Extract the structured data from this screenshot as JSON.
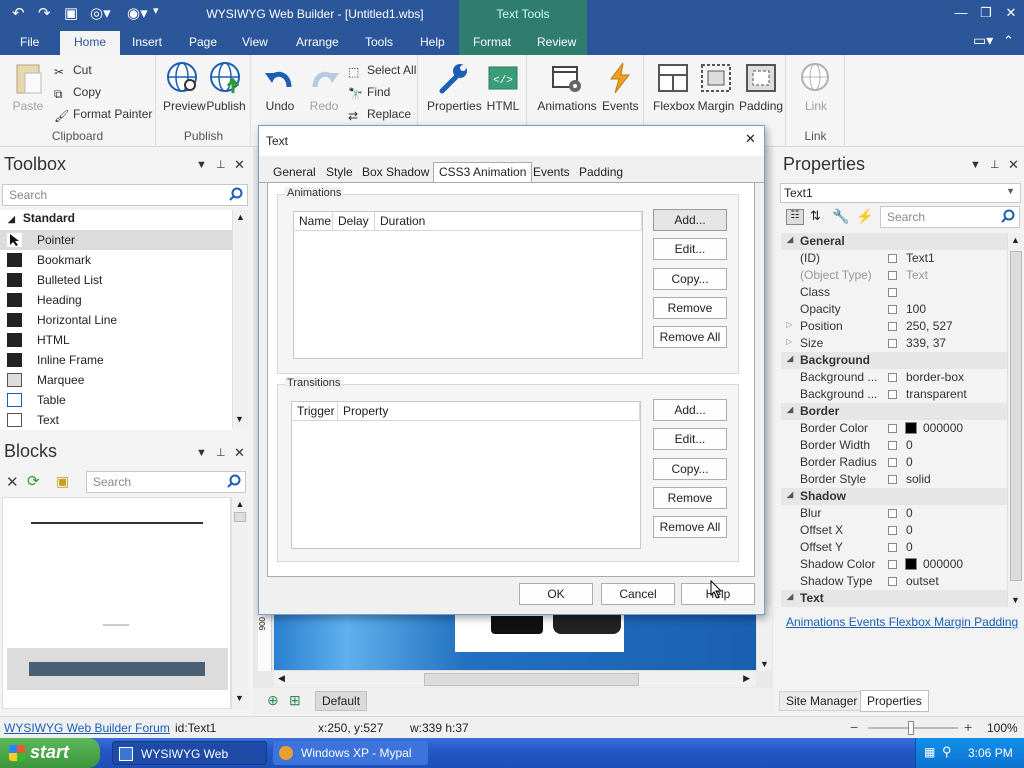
{
  "titlebar": {
    "title": "WYSIWYG Web Builder - [Untitled1.wbs]",
    "context_tab": "Text Tools"
  },
  "menu_tabs": [
    "File",
    "Home",
    "Insert",
    "Page",
    "View",
    "Arrange",
    "Tools",
    "Help",
    "Format",
    "Review"
  ],
  "active_tab": "Home",
  "ribbon": {
    "clipboard": {
      "paste": "Paste",
      "cut": "Cut",
      "copy": "Copy",
      "format_painter": "Format Painter",
      "label": "Clipboard"
    },
    "publish": {
      "preview": "Preview",
      "publish": "Publish",
      "label": "Publish"
    },
    "edit": {
      "undo": "Undo",
      "redo": "Redo",
      "select_all": "Select All",
      "find": "Find",
      "replace": "Replace"
    },
    "props": {
      "properties": "Properties",
      "html": "HTML"
    },
    "anim": {
      "animations": "Animations",
      "events": "Events"
    },
    "layout": {
      "flexbox": "Flexbox",
      "margin": "Margin",
      "padding": "Padding"
    },
    "link": {
      "link": "Link",
      "label": "Link"
    }
  },
  "toolbox": {
    "title": "Toolbox",
    "search_placeholder": "Search",
    "section": "Standard",
    "items": [
      "Pointer",
      "Bookmark",
      "Bulleted List",
      "Heading",
      "Horizontal Line",
      "HTML",
      "Inline Frame",
      "Marquee",
      "Table",
      "Text"
    ]
  },
  "blocks": {
    "title": "Blocks",
    "search_placeholder": "Search"
  },
  "dialog": {
    "title": "Text",
    "tabs": [
      "General",
      "Style",
      "Box Shadow",
      "CSS3 Animation",
      "Events",
      "Padding"
    ],
    "active_tab": "CSS3 Animation",
    "animations": {
      "title": "Animations",
      "columns": [
        "Name",
        "Delay",
        "Duration"
      ],
      "buttons": [
        "Add...",
        "Edit...",
        "Copy...",
        "Remove",
        "Remove All"
      ]
    },
    "transitions": {
      "title": "Transitions",
      "columns": [
        "Trigger",
        "Property"
      ],
      "buttons": [
        "Add...",
        "Edit...",
        "Copy...",
        "Remove",
        "Remove All"
      ]
    },
    "footer": {
      "ok": "OK",
      "cancel": "Cancel",
      "help": "Help"
    }
  },
  "properties": {
    "title": "Properties",
    "selected": "Text1",
    "search_placeholder": "Search",
    "rows": [
      {
        "cat": true,
        "name": "General"
      },
      {
        "name": "(ID)",
        "value": "Text1"
      },
      {
        "name": "(Object Type)",
        "value": "Text",
        "muted": true
      },
      {
        "name": "Class",
        "value": ""
      },
      {
        "name": "Opacity",
        "value": "100"
      },
      {
        "name": "Position",
        "value": "250, 527",
        "expand": true
      },
      {
        "name": "Size",
        "value": "339, 37",
        "expand": true
      },
      {
        "cat": true,
        "name": "Background"
      },
      {
        "name": "Background ...",
        "value": "border-box"
      },
      {
        "name": "Background ...",
        "value": "transparent"
      },
      {
        "cat": true,
        "name": "Border"
      },
      {
        "name": "Border Color",
        "value": "000000",
        "swatch": "#000000"
      },
      {
        "name": "Border Width",
        "value": "0"
      },
      {
        "name": "Border Radius",
        "value": "0"
      },
      {
        "name": "Border Style",
        "value": "solid"
      },
      {
        "cat": true,
        "name": "Shadow"
      },
      {
        "name": "Blur",
        "value": "0"
      },
      {
        "name": "Offset X",
        "value": "0"
      },
      {
        "name": "Offset Y",
        "value": "0"
      },
      {
        "name": "Shadow Color",
        "value": "000000",
        "swatch": "#000000"
      },
      {
        "name": "Shadow Type",
        "value": "outset"
      },
      {
        "cat": true,
        "name": "Text"
      }
    ],
    "links": [
      "Animations",
      "Events",
      "Flexbox",
      "Margin",
      "Padding"
    ]
  },
  "bottom_tabs": {
    "site_manager": "Site Manager",
    "properties": "Properties",
    "default": "Default"
  },
  "statusbar": {
    "forum": "WYSIWYG Web Builder Forum",
    "id": "id:Text1",
    "coords": "x:250, y:527",
    "size": "w:339 h:37",
    "zoom": "100%"
  },
  "taskbar": {
    "start": "start",
    "items": [
      "WYSIWYG Web Build...",
      "Windows XP - Mypal"
    ],
    "clock": "3:06 PM"
  },
  "ruler_mark": "900",
  "colors": {
    "titlebar": "#2b579a",
    "context": "#2e7d6f",
    "link": "#1a5fb4"
  }
}
